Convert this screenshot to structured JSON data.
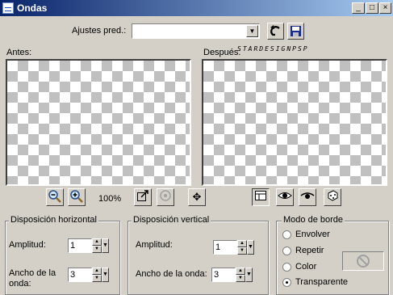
{
  "window": {
    "title": "Ondas"
  },
  "titlebar_buttons": {
    "minimize": "_",
    "maximize": "□",
    "close": "×"
  },
  "presets": {
    "label": "Ajustes pred.:",
    "value": ""
  },
  "preview": {
    "before_label": "Antes:",
    "after_label": "Después:",
    "watermark": "STARDESIGNPSP"
  },
  "zoom": {
    "level": "100%"
  },
  "horizontal": {
    "title": "Disposición horizontal",
    "amplitude_label": "Amplitud:",
    "amplitude_value": "1",
    "wavelength_label_1": "Ancho de la",
    "wavelength_label_2": "onda:",
    "wavelength_value": "3"
  },
  "vertical": {
    "title": "Disposición vertical",
    "amplitude_label": "Amplitud:",
    "amplitude_value": "1",
    "wavelength_label": "Ancho de la onda:",
    "wavelength_value": "3"
  },
  "edge_mode": {
    "title": "Modo de borde",
    "options": [
      "Envolver",
      "Repetir",
      "Color",
      "Transparente"
    ],
    "selected": "Transparente"
  },
  "icons": {
    "zoom_out": "magnifier-minus-icon",
    "zoom_in": "magnifier-plus-icon",
    "proof": "proof-icon",
    "pan": "pan-move-icon"
  }
}
